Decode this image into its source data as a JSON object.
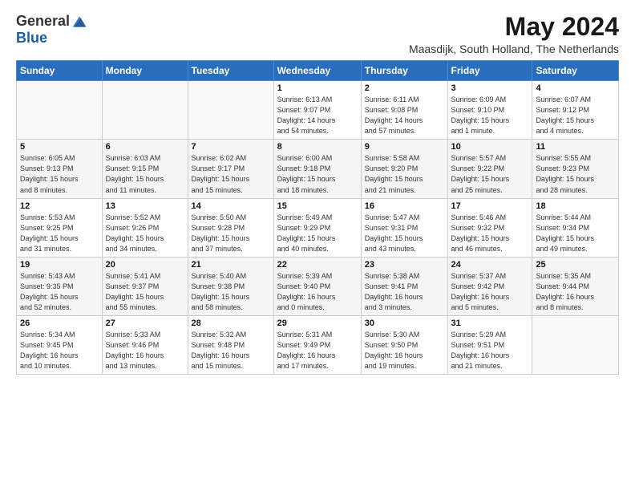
{
  "logo": {
    "general": "General",
    "blue": "Blue"
  },
  "title": "May 2024",
  "location": "Maasdijk, South Holland, The Netherlands",
  "weekdays": [
    "Sunday",
    "Monday",
    "Tuesday",
    "Wednesday",
    "Thursday",
    "Friday",
    "Saturday"
  ],
  "weeks": [
    [
      {
        "day": "",
        "info": ""
      },
      {
        "day": "",
        "info": ""
      },
      {
        "day": "",
        "info": ""
      },
      {
        "day": "1",
        "info": "Sunrise: 6:13 AM\nSunset: 9:07 PM\nDaylight: 14 hours\nand 54 minutes."
      },
      {
        "day": "2",
        "info": "Sunrise: 6:11 AM\nSunset: 9:08 PM\nDaylight: 14 hours\nand 57 minutes."
      },
      {
        "day": "3",
        "info": "Sunrise: 6:09 AM\nSunset: 9:10 PM\nDaylight: 15 hours\nand 1 minute."
      },
      {
        "day": "4",
        "info": "Sunrise: 6:07 AM\nSunset: 9:12 PM\nDaylight: 15 hours\nand 4 minutes."
      }
    ],
    [
      {
        "day": "5",
        "info": "Sunrise: 6:05 AM\nSunset: 9:13 PM\nDaylight: 15 hours\nand 8 minutes."
      },
      {
        "day": "6",
        "info": "Sunrise: 6:03 AM\nSunset: 9:15 PM\nDaylight: 15 hours\nand 11 minutes."
      },
      {
        "day": "7",
        "info": "Sunrise: 6:02 AM\nSunset: 9:17 PM\nDaylight: 15 hours\nand 15 minutes."
      },
      {
        "day": "8",
        "info": "Sunrise: 6:00 AM\nSunset: 9:18 PM\nDaylight: 15 hours\nand 18 minutes."
      },
      {
        "day": "9",
        "info": "Sunrise: 5:58 AM\nSunset: 9:20 PM\nDaylight: 15 hours\nand 21 minutes."
      },
      {
        "day": "10",
        "info": "Sunrise: 5:57 AM\nSunset: 9:22 PM\nDaylight: 15 hours\nand 25 minutes."
      },
      {
        "day": "11",
        "info": "Sunrise: 5:55 AM\nSunset: 9:23 PM\nDaylight: 15 hours\nand 28 minutes."
      }
    ],
    [
      {
        "day": "12",
        "info": "Sunrise: 5:53 AM\nSunset: 9:25 PM\nDaylight: 15 hours\nand 31 minutes."
      },
      {
        "day": "13",
        "info": "Sunrise: 5:52 AM\nSunset: 9:26 PM\nDaylight: 15 hours\nand 34 minutes."
      },
      {
        "day": "14",
        "info": "Sunrise: 5:50 AM\nSunset: 9:28 PM\nDaylight: 15 hours\nand 37 minutes."
      },
      {
        "day": "15",
        "info": "Sunrise: 5:49 AM\nSunset: 9:29 PM\nDaylight: 15 hours\nand 40 minutes."
      },
      {
        "day": "16",
        "info": "Sunrise: 5:47 AM\nSunset: 9:31 PM\nDaylight: 15 hours\nand 43 minutes."
      },
      {
        "day": "17",
        "info": "Sunrise: 5:46 AM\nSunset: 9:32 PM\nDaylight: 15 hours\nand 46 minutes."
      },
      {
        "day": "18",
        "info": "Sunrise: 5:44 AM\nSunset: 9:34 PM\nDaylight: 15 hours\nand 49 minutes."
      }
    ],
    [
      {
        "day": "19",
        "info": "Sunrise: 5:43 AM\nSunset: 9:35 PM\nDaylight: 15 hours\nand 52 minutes."
      },
      {
        "day": "20",
        "info": "Sunrise: 5:41 AM\nSunset: 9:37 PM\nDaylight: 15 hours\nand 55 minutes."
      },
      {
        "day": "21",
        "info": "Sunrise: 5:40 AM\nSunset: 9:38 PM\nDaylight: 15 hours\nand 58 minutes."
      },
      {
        "day": "22",
        "info": "Sunrise: 5:39 AM\nSunset: 9:40 PM\nDaylight: 16 hours\nand 0 minutes."
      },
      {
        "day": "23",
        "info": "Sunrise: 5:38 AM\nSunset: 9:41 PM\nDaylight: 16 hours\nand 3 minutes."
      },
      {
        "day": "24",
        "info": "Sunrise: 5:37 AM\nSunset: 9:42 PM\nDaylight: 16 hours\nand 5 minutes."
      },
      {
        "day": "25",
        "info": "Sunrise: 5:35 AM\nSunset: 9:44 PM\nDaylight: 16 hours\nand 8 minutes."
      }
    ],
    [
      {
        "day": "26",
        "info": "Sunrise: 5:34 AM\nSunset: 9:45 PM\nDaylight: 16 hours\nand 10 minutes."
      },
      {
        "day": "27",
        "info": "Sunrise: 5:33 AM\nSunset: 9:46 PM\nDaylight: 16 hours\nand 13 minutes."
      },
      {
        "day": "28",
        "info": "Sunrise: 5:32 AM\nSunset: 9:48 PM\nDaylight: 16 hours\nand 15 minutes."
      },
      {
        "day": "29",
        "info": "Sunrise: 5:31 AM\nSunset: 9:49 PM\nDaylight: 16 hours\nand 17 minutes."
      },
      {
        "day": "30",
        "info": "Sunrise: 5:30 AM\nSunset: 9:50 PM\nDaylight: 16 hours\nand 19 minutes."
      },
      {
        "day": "31",
        "info": "Sunrise: 5:29 AM\nSunset: 9:51 PM\nDaylight: 16 hours\nand 21 minutes."
      },
      {
        "day": "",
        "info": ""
      }
    ]
  ]
}
